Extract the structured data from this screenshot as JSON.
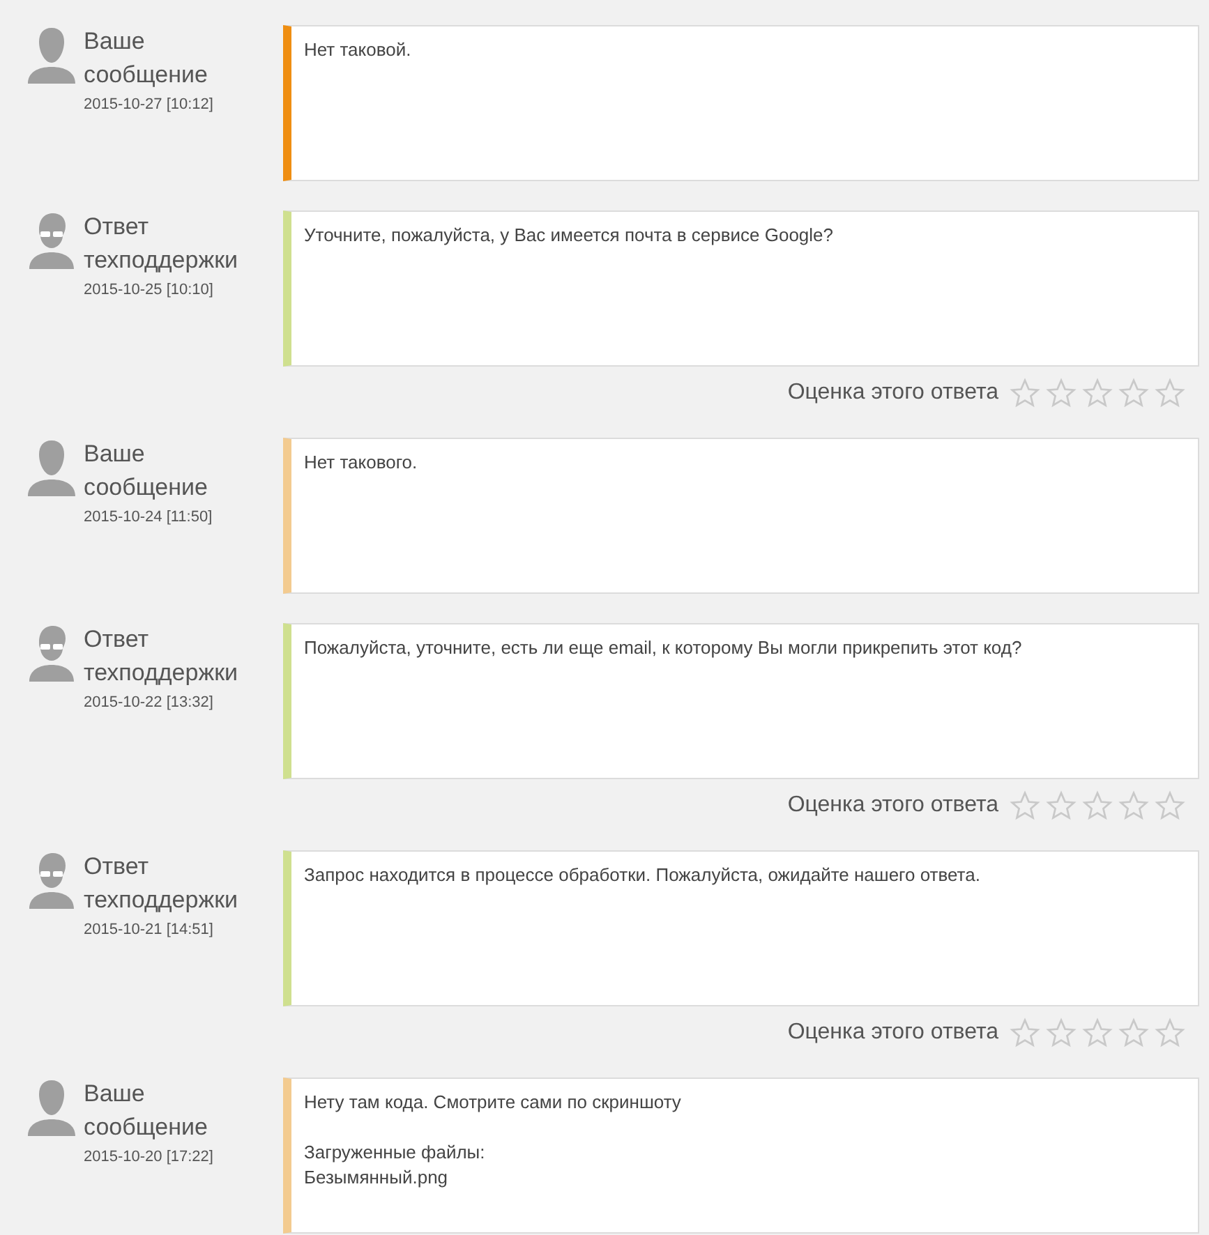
{
  "messages": [
    {
      "kind": "user",
      "author": "Ваше сообщение",
      "date": "2015-10-27 [10:12]",
      "color": "#ef8e12",
      "text": "Нет таковой."
    },
    {
      "kind": "support",
      "author": "Ответ техподдержки",
      "date": "2015-10-25 [10:10]",
      "color": "#cfe08f",
      "text": "Уточните, пожалуйста, у Вас имеется почта в сервисе Google?",
      "rating": {
        "label": "Оценка этого ответа",
        "stars": 0
      }
    },
    {
      "kind": "user",
      "author": "Ваше сообщение",
      "date": "2015-10-24 [11:50]",
      "color": "#f3cb90",
      "text": "Нет такового."
    },
    {
      "kind": "support",
      "author": "Ответ техподдержки",
      "date": "2015-10-22 [13:32]",
      "color": "#cfe08f",
      "text": "Пожалуйста, уточните, есть ли еще email, к которому Вы могли прикрепить этот код?",
      "rating": {
        "label": "Оценка этого ответа",
        "stars": 0
      }
    },
    {
      "kind": "support",
      "author": "Ответ техподдержки",
      "date": "2015-10-21 [14:51]",
      "color": "#cfe08f",
      "text": "Запрос находится в процессе обработки. Пожалуйста, ожидайте нашего ответа.",
      "rating": {
        "label": "Оценка этого ответа",
        "stars": 0
      }
    },
    {
      "kind": "user",
      "author": "Ваше сообщение",
      "date": "2015-10-20 [17:22]",
      "color": "#f3cb90",
      "text": "Нету там кода. Смотрите сами по скриншоту",
      "attachments_label": "Загруженные файлы:",
      "attachments": [
        "Безымянный.png"
      ]
    }
  ]
}
